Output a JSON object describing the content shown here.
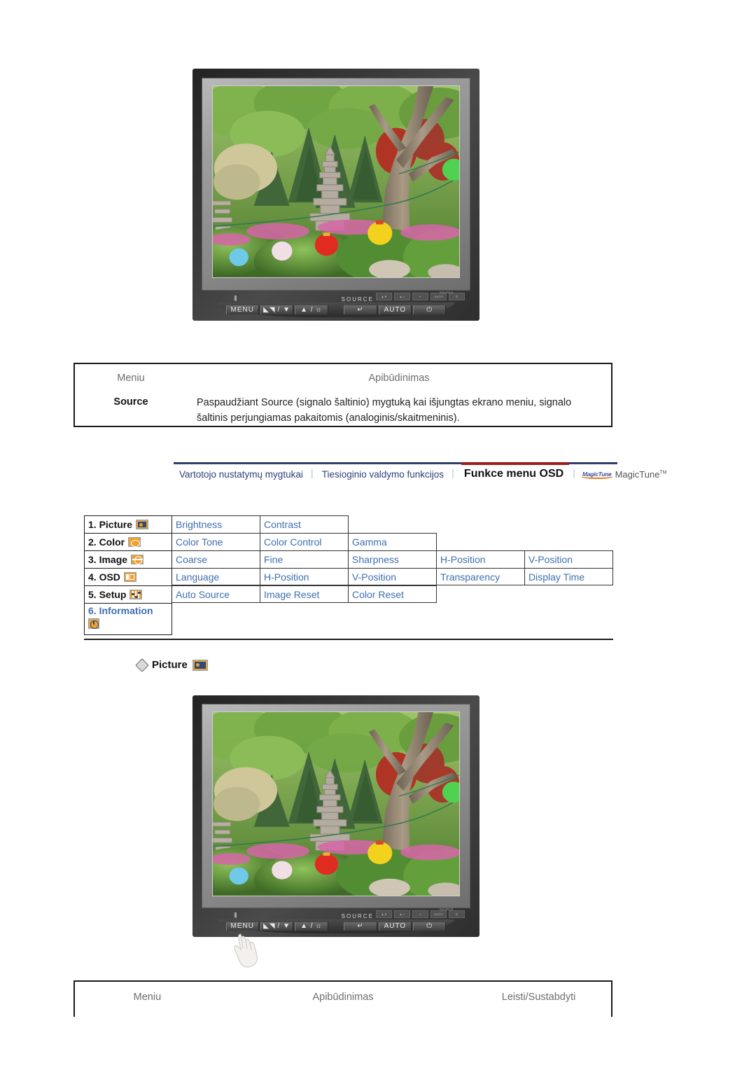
{
  "page": {
    "language": "lt",
    "accent_blue": "#3e6fae",
    "accent_red": "#9e1b1b",
    "nav_rule_blue": "#2f3e6b",
    "osd_icon_orange": "#f0a030"
  },
  "monitor_top": {
    "name": "monitor-illustration",
    "buttons": [
      {
        "label": "MENU",
        "icon": "menu-icon"
      },
      {
        "label": "/ ▼",
        "icon": "image-down-icon"
      },
      {
        "label": "▲ /",
        "icon": "brightness-up-icon"
      },
      {
        "label": "↵",
        "icon": "enter-icon"
      },
      {
        "label": "AUTO",
        "icon": "auto-icon"
      },
      {
        "label": "⏻",
        "icon": "power-icon"
      }
    ],
    "source_caption": "SOURCE",
    "screen_alt": "Garden scene with stone pagoda, trees and colored paper lanterns"
  },
  "source_table": {
    "headers": {
      "menu": "Meniu",
      "description": "Apibūdinimas"
    },
    "rows": [
      {
        "menu": "Source",
        "description": "Paspaudžiant Source (signalo šaltinio) mygtuką kai išjungtas ekrano meniu, signalo šaltinis perjungiamas pakaitomis (analoginis/skaitmeninis)."
      }
    ]
  },
  "nav": {
    "items": [
      {
        "label": "Vartotojo nustatymų mygtukai",
        "active": false
      },
      {
        "label": "Tiesioginio valdymo funkcijos",
        "active": false
      },
      {
        "label": "Funkce menu OSD",
        "active": true
      }
    ],
    "separator": "│",
    "magictune": {
      "mark": "MagicTune",
      "text": "MagicTune",
      "tm": "TM"
    }
  },
  "osd_menu": {
    "rows": [
      {
        "key": "1. Picture",
        "icon": "picture-icon",
        "values": [
          "Brightness",
          "Contrast"
        ]
      },
      {
        "key": "2. Color",
        "icon": "color-icon",
        "values": [
          "Color Tone",
          "Color Control",
          "Gamma"
        ]
      },
      {
        "key": "3. Image",
        "icon": "image-icon",
        "values": [
          "Coarse",
          "Fine",
          "Sharpness",
          "H-Position",
          "V-Position"
        ]
      },
      {
        "key": "4. OSD",
        "icon": "osd-icon",
        "values": [
          "Language",
          "H-Position",
          "V-Position",
          "Transparency",
          "Display Time"
        ]
      },
      {
        "key": "5. Setup",
        "icon": "setup-icon",
        "values": [
          "Auto Source",
          "Image Reset",
          "Color Reset"
        ]
      },
      {
        "key": "6. Information",
        "icon": "information-icon",
        "values": []
      }
    ]
  },
  "picture_section": {
    "heading": "Picture",
    "icon": "picture-icon"
  },
  "monitor_bottom": {
    "name": "monitor-illustration-picture",
    "buttons": [
      {
        "label": "MENU",
        "icon": "menu-icon"
      },
      {
        "label": "/ ▼",
        "icon": "image-down-icon"
      },
      {
        "label": "▲ /",
        "icon": "brightness-up-icon"
      },
      {
        "label": "↵",
        "icon": "enter-icon"
      },
      {
        "label": "AUTO",
        "icon": "auto-icon"
      },
      {
        "label": "⏻",
        "icon": "power-icon"
      }
    ],
    "source_caption": "SOURCE",
    "pointer": "hand-pointer-icon"
  },
  "bottom_table": {
    "headers": {
      "menu": "Meniu",
      "description": "Apibūdinimas",
      "playstop": "Leisti/Sustabdyti"
    }
  }
}
